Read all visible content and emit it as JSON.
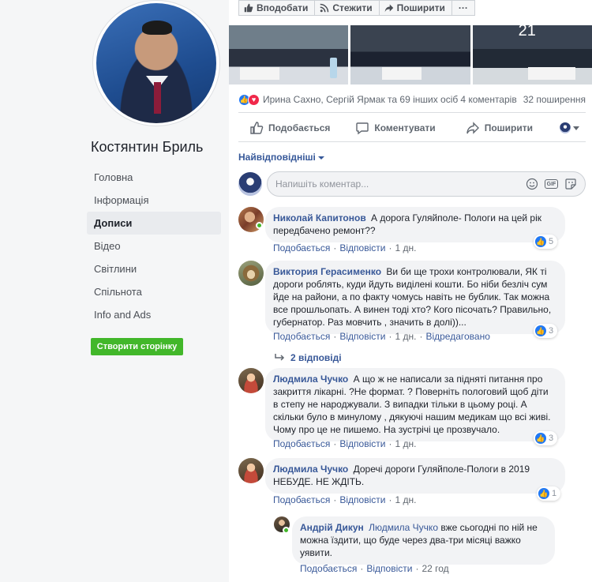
{
  "profile": {
    "name": "Костянтин Бриль",
    "nav": [
      "Головна",
      "Інформація",
      "Дописи",
      "Відео",
      "Світлини",
      "Спільнота",
      "Info and Ads"
    ],
    "active_nav": "Дописи",
    "create_page_button": "Створити сторінку"
  },
  "post": {
    "top_actions": {
      "like": "Вподобати",
      "follow": "Стежити",
      "share": "Поширити",
      "more": "···"
    },
    "photo_overlay_text": "21",
    "reactions_text": "Ирина Сахно, Сергій Ярмак та 69 інших осіб",
    "comments_count": "4 коментарів",
    "shares_count": "32 поширення",
    "actions": {
      "like": "Подобається",
      "comment": "Коментувати",
      "share": "Поширити"
    },
    "sort_label": "Найвідповідніші",
    "comment_placeholder": "Напишіть коментар..."
  },
  "comments": [
    {
      "author": "Николай Капитонов",
      "text": "А дорога Гуляйполе- Пологи на цей рік передбачено ремонт??",
      "like": "Подобається",
      "reply": "Відповісти",
      "time": "1 дн.",
      "reactions": "5",
      "online": true
    },
    {
      "author": "Виктория Герасименко",
      "text": "Ви би ще трохи контролювали, ЯК ті дороги роблять, куди йдуть виділені кошти. Бо ніби безліч сум йде на райони, а по факту чомусь навіть не бублик. Так можна все прошльопать. А винен тоді хто? Кого пісочать? Правильно, губернатор. Раз мовчить , значить в долі))...",
      "like": "Подобається",
      "reply": "Відповісти",
      "time": "1 дн.",
      "edited": "Відредаговано",
      "reactions": "3",
      "replies_link": "2 відповіді"
    },
    {
      "author": "Людмила Чучко",
      "text": "А що ж не написали за підняті питання про закриття лікарні. ?Не формат. ? Поверніть пологовий щоб діти в степу не народжували. З випадки тільки в цьому році. А скільки було в минулому , дякуючі нашим медикам що всі живі. Чому про це не пишемо. На зустрічі це прозвучало.",
      "like": "Подобається",
      "reply": "Відповісти",
      "time": "1 дн.",
      "reactions": "3"
    },
    {
      "author": "Людмила Чучко",
      "text": "Доречі дороги Гуляйполе-Пологи в 2019 НЕБУДЕ. НЕ ЖДІТЬ.",
      "like": "Подобається",
      "reply": "Відповісти",
      "time": "1 дн.",
      "reactions": "1"
    }
  ],
  "reply": {
    "author": "Андрій Дикун",
    "mention": "Людмила Чучко",
    "text": "вже сьогодні по ній не можна їздити, що буде через два-три місяці важко уявити.",
    "like": "Подобається",
    "reply": "Відповісти",
    "time": "22 год",
    "online": true
  },
  "colors": {
    "link": "#385898",
    "accent_blue": "#2078f4",
    "create_button": "#42b72a",
    "bubble": "#f2f3f5"
  }
}
